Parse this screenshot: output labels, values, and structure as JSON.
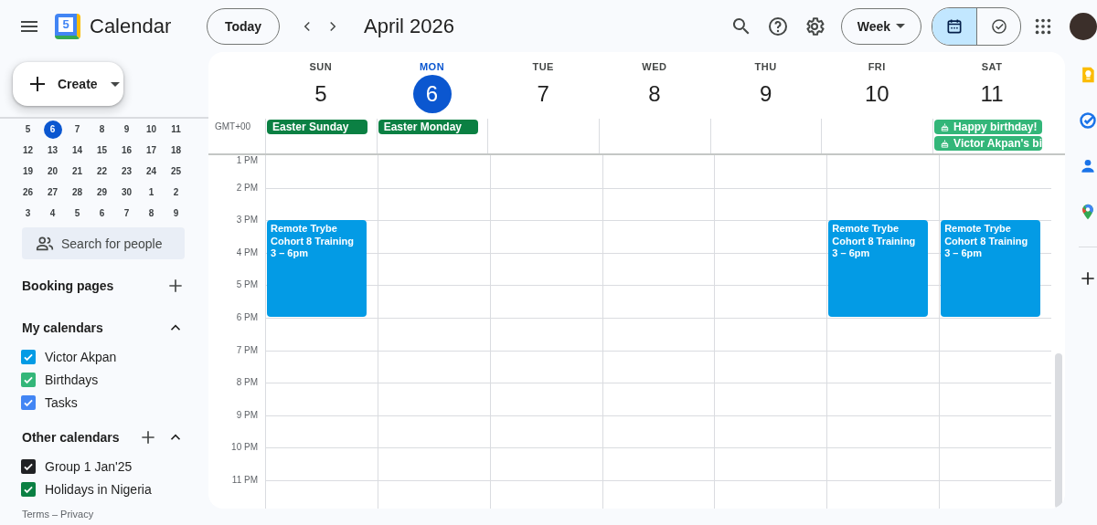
{
  "header": {
    "app_name": "Calendar",
    "logo_text": "5",
    "today_button": "Today",
    "title": "April 2026",
    "view_select": "Week",
    "view_toggle": [
      {
        "kind": "calendar",
        "selected": true
      },
      {
        "kind": "tasks",
        "selected": false
      }
    ]
  },
  "sidebar": {
    "create_button": "Create",
    "mini_calendar": {
      "weeks": [
        [
          {
            "day": "5",
            "selected": false
          },
          {
            "day": "6",
            "selected": true
          },
          {
            "day": "7",
            "selected": false
          },
          {
            "day": "8",
            "selected": false
          },
          {
            "day": "9",
            "selected": false
          },
          {
            "day": "10",
            "selected": false
          },
          {
            "day": "11",
            "selected": false
          }
        ],
        [
          {
            "day": "12",
            "selected": false
          },
          {
            "day": "13",
            "selected": false
          },
          {
            "day": "14",
            "selected": false
          },
          {
            "day": "15",
            "selected": false
          },
          {
            "day": "16",
            "selected": false
          },
          {
            "day": "17",
            "selected": false
          },
          {
            "day": "18",
            "selected": false
          }
        ],
        [
          {
            "day": "19",
            "selected": false
          },
          {
            "day": "20",
            "selected": false
          },
          {
            "day": "21",
            "selected": false
          },
          {
            "day": "22",
            "selected": false
          },
          {
            "day": "23",
            "selected": false
          },
          {
            "day": "24",
            "selected": false
          },
          {
            "day": "25",
            "selected": false
          }
        ],
        [
          {
            "day": "26",
            "selected": false
          },
          {
            "day": "27",
            "selected": false
          },
          {
            "day": "28",
            "selected": false
          },
          {
            "day": "29",
            "selected": false
          },
          {
            "day": "30",
            "selected": false
          },
          {
            "day": "1",
            "selected": false
          },
          {
            "day": "2",
            "selected": false
          }
        ],
        [
          {
            "day": "3",
            "selected": false
          },
          {
            "day": "4",
            "selected": false
          },
          {
            "day": "5",
            "selected": false
          },
          {
            "day": "6",
            "selected": false
          },
          {
            "day": "7",
            "selected": false
          },
          {
            "day": "8",
            "selected": false
          },
          {
            "day": "9",
            "selected": false
          }
        ]
      ]
    },
    "people_search": {
      "placeholder": "Search for people"
    },
    "booking_pages": {
      "title": "Booking pages"
    },
    "my_calendars": {
      "title": "My calendars",
      "expanded": true,
      "items": [
        {
          "label": "Victor Akpan",
          "checked": true,
          "color": "#039be5"
        },
        {
          "label": "Birthdays",
          "checked": true,
          "color": "#33b679"
        },
        {
          "label": "Tasks",
          "checked": true,
          "color": "#4285f4"
        }
      ]
    },
    "other_calendars": {
      "title": "Other calendars",
      "expanded": true,
      "items": [
        {
          "label": "Group 1 Jan'25",
          "checked": true,
          "color": "#202124"
        },
        {
          "label": "Holidays in Nigeria",
          "checked": true,
          "color": "#0b8043"
        }
      ]
    },
    "footer": {
      "terms": "Terms",
      "separator": "–",
      "privacy": "Privacy"
    }
  },
  "week": {
    "timezone": "GMT+00",
    "hours": [
      "1 PM",
      "2 PM",
      "3 PM",
      "4 PM",
      "5 PM",
      "6 PM",
      "7 PM",
      "8 PM",
      "9 PM",
      "10 PM",
      "11 PM"
    ],
    "days": [
      {
        "weekday": "SUN",
        "date": "5",
        "today": false,
        "all_day": [
          {
            "kind": "holiday",
            "title": "Easter Sunday",
            "color": "#0b8043"
          }
        ],
        "events": [
          {
            "title": "Remote Trybe Cohort 8 Training",
            "time": "3 – 6pm",
            "color": "#039be5"
          }
        ]
      },
      {
        "weekday": "MON",
        "date": "6",
        "today": true,
        "all_day": [
          {
            "kind": "holiday",
            "title": "Easter Monday",
            "color": "#0b8043"
          }
        ]
      },
      {
        "weekday": "TUE",
        "date": "7",
        "today": false
      },
      {
        "weekday": "WED",
        "date": "8",
        "today": false
      },
      {
        "weekday": "THU",
        "date": "9",
        "today": false
      },
      {
        "weekday": "FRI",
        "date": "10",
        "today": false,
        "events": [
          {
            "title": "Remote Trybe Cohort 8 Training",
            "time": "3 – 6pm",
            "color": "#039be5"
          }
        ]
      },
      {
        "weekday": "SAT",
        "date": "11",
        "today": false,
        "all_day": [
          {
            "kind": "birthday",
            "title": "Happy birthday!",
            "color": "#33b679"
          },
          {
            "kind": "birthday",
            "title": "Victor Akpan's bi",
            "color": "#33b679"
          }
        ],
        "events": [
          {
            "title": "Remote Trybe Cohort 8 Training",
            "time": "3 – 6pm",
            "color": "#039be5"
          }
        ]
      }
    ]
  }
}
